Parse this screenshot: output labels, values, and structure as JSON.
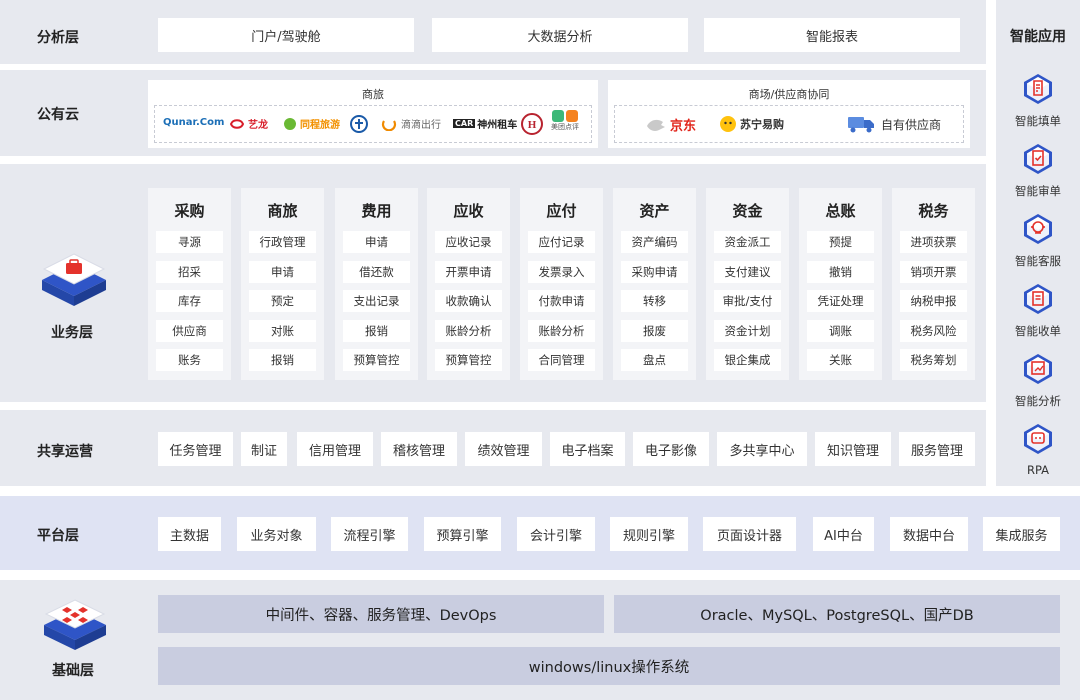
{
  "layers": {
    "analysis": "分析层",
    "public_cloud": "公有云",
    "business": "业务层",
    "shared_ops": "共享运营",
    "platform": "平台层",
    "infrastructure": "基础层"
  },
  "analysis_items": [
    "门户/驾驶舱",
    "大数据分析",
    "智能报表"
  ],
  "public_cloud": {
    "travel": {
      "title": "商旅",
      "logos": [
        "Qunar.Com",
        "艺龙",
        "同程旅游",
        "铁路",
        "滴滴出行",
        "神州租车",
        "华住",
        "美团点评"
      ]
    },
    "mall": {
      "title": "商场/供应商协同",
      "logos": [
        "京东",
        "苏宁易购",
        "自有供应商"
      ]
    }
  },
  "modules": [
    {
      "title": "采购",
      "items": [
        "寻源",
        "招采",
        "库存",
        "供应商",
        "账务"
      ]
    },
    {
      "title": "商旅",
      "items": [
        "行政管理",
        "申请",
        "预定",
        "对账",
        "报销"
      ]
    },
    {
      "title": "费用",
      "items": [
        "申请",
        "借还款",
        "支出记录",
        "报销",
        "预算管控"
      ]
    },
    {
      "title": "应收",
      "items": [
        "应收记录",
        "开票申请",
        "收款确认",
        "账龄分析",
        "预算管控"
      ]
    },
    {
      "title": "应付",
      "items": [
        "应付记录",
        "发票录入",
        "付款申请",
        "账龄分析",
        "合同管理"
      ]
    },
    {
      "title": "资产",
      "items": [
        "资产编码",
        "采购申请",
        "转移",
        "报废",
        "盘点"
      ]
    },
    {
      "title": "资金",
      "items": [
        "资金派工",
        "支付建议",
        "审批/支付",
        "资金计划",
        "银企集成"
      ]
    },
    {
      "title": "总账",
      "items": [
        "预提",
        "撤销",
        "凭证处理",
        "调账",
        "关账"
      ]
    },
    {
      "title": "税务",
      "items": [
        "进项获票",
        "销项开票",
        "纳税申报",
        "税务风险",
        "税务筹划"
      ]
    }
  ],
  "shared_items": [
    "任务管理",
    "制证",
    "信用管理",
    "稽核管理",
    "绩效管理",
    "电子档案",
    "电子影像",
    "多共享中心",
    "知识管理",
    "服务管理"
  ],
  "platform_items": [
    "主数据",
    "业务对象",
    "流程引擎",
    "预算引擎",
    "会计引擎",
    "规则引擎",
    "页面设计器",
    "AI中台",
    "数据中台",
    "集成服务"
  ],
  "infrastructure_items": [
    "中间件、容器、服务管理、DevOps",
    "Oracle、MySQL、PostgreSQL、国产DB",
    "windows/linux操作系统"
  ],
  "smart_apps": {
    "title": "智能应用",
    "items": [
      "智能填单",
      "智能审单",
      "智能客服",
      "智能收单",
      "智能分析",
      "RPA"
    ]
  },
  "colors": {
    "band": "#e7e9ef",
    "platform_band": "#dfe3f3",
    "accent_red": "#e4322b",
    "accent_blue": "#2f55c7",
    "infra_box": "#c9cde0"
  }
}
